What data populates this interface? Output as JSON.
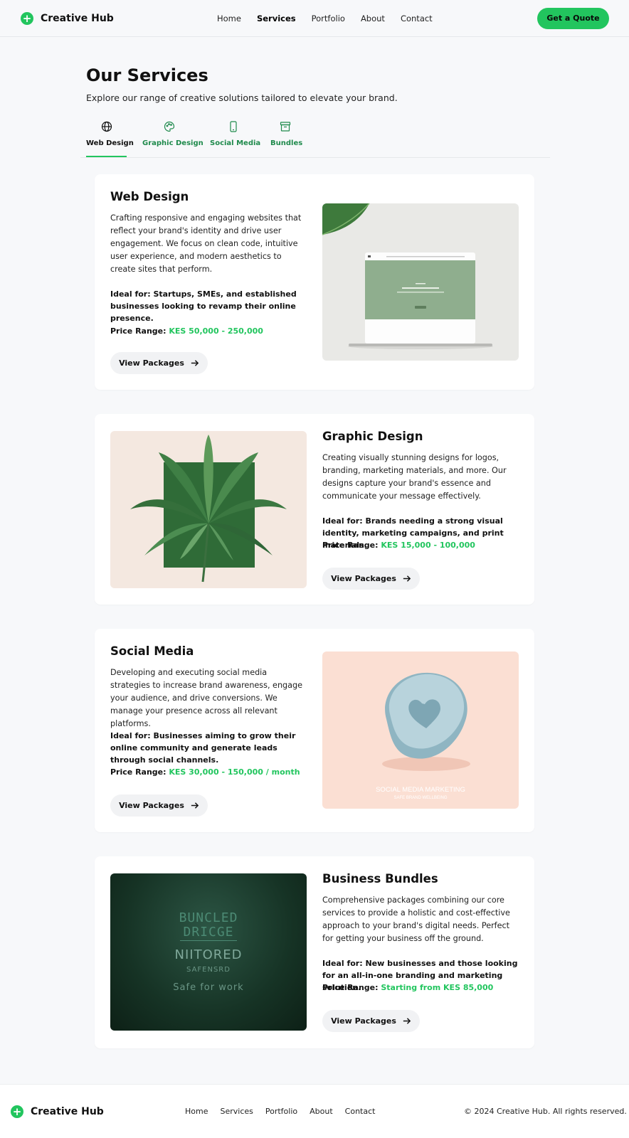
{
  "brand": {
    "name": "Creative Hub",
    "accent": "#22c55e"
  },
  "nav": [
    {
      "label": "Home"
    },
    {
      "label": "Services",
      "active": true
    },
    {
      "label": "Portfolio"
    },
    {
      "label": "About"
    },
    {
      "label": "Contact"
    }
  ],
  "header": {
    "cta_label": "Get a Quote"
  },
  "hero": {
    "title": "Our Services",
    "subtitle": "Explore our range of creative solutions tailored to elevate your brand."
  },
  "tabs": [
    {
      "label": "Web Design",
      "icon": "globe-icon",
      "active": true
    },
    {
      "label": "Graphic Design",
      "icon": "palette-icon"
    },
    {
      "label": "Social Media",
      "icon": "phone-icon"
    },
    {
      "label": "Bundles",
      "icon": "archive-icon"
    }
  ],
  "services": [
    {
      "title": "Web Design",
      "description": "Crafting responsive and engaging websites that reflect your brand's identity and drive user engagement. We focus on clean code, intuitive user experience, and modern aesthetics to create sites that perform.",
      "ideal": "Ideal for: Startups, SMEs, and established businesses looking to revamp their online presence.",
      "price_label": "Price Range:",
      "price_value": "KES 50,000 - 250,000",
      "button": "View Packages"
    },
    {
      "title": "Graphic Design",
      "description": "Creating visually stunning designs for logos, branding, marketing materials, and more. Our designs capture your brand's essence and communicate your message effectively.",
      "ideal": "Ideal for: Brands needing a strong visual identity, marketing campaigns, and print materials.",
      "price_label": "Price Range:",
      "price_value": "KES 15,000 - 100,000",
      "button": "View Packages"
    },
    {
      "title": "Social Media",
      "description": "Developing and executing social media strategies to increase brand awareness, engage your audience, and drive conversions. We manage your presence across all relevant platforms.",
      "ideal": "Ideal for: Businesses aiming to grow their online community and generate leads through social channels.",
      "price_label": "Price Range:",
      "price_value": "KES 30,000 - 150,000 / month",
      "button": "View Packages",
      "image_text": [
        "SOCIAL MEDIA MARKETING",
        "SAFE BRAND WELLBEING"
      ]
    },
    {
      "title": "Business Bundles",
      "description": "Comprehensive packages combining our core services to provide a holistic and cost-effective approach to your brand's digital needs. Perfect for getting your business off the ground.",
      "ideal": "Ideal for: New businesses and those looking for an all-in-one branding and marketing solution.",
      "price_label": "Price Range:",
      "price_value": "Starting from KES 85,000",
      "button": "View Packages",
      "image_text": [
        "BUNCLED",
        "DRICGE",
        "NIITORED",
        "SAFENSRD",
        "Safe for work"
      ]
    }
  ],
  "footer": {
    "nav": [
      "Home",
      "Services",
      "Portfolio",
      "About",
      "Contact"
    ],
    "copyright": "© 2024 Creative Hub. All rights reserved."
  }
}
